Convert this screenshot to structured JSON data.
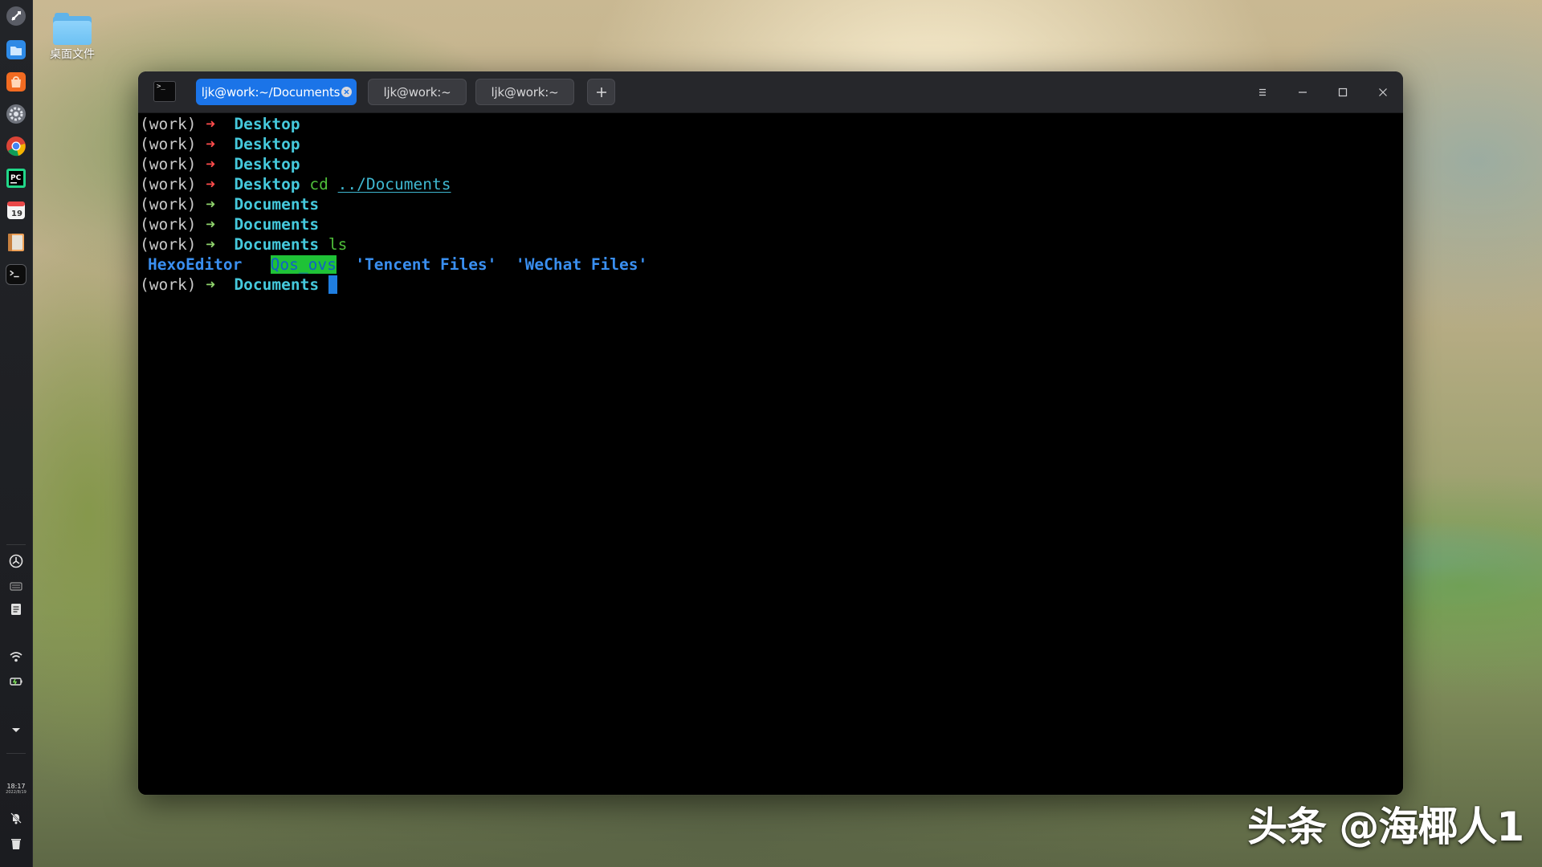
{
  "desktop": {
    "folder_label": "桌面文件"
  },
  "dock": {
    "apps": [
      "launcher-icon",
      "file-manager-icon",
      "app-store-icon",
      "settings-icon",
      "chrome-icon",
      "pycharm-icon",
      "calendar-icon",
      "notes-icon",
      "terminal-icon"
    ],
    "calendar_day": "19",
    "pycharm_text": "PC",
    "clock_time": "18:17",
    "clock_date": "2022/8/19"
  },
  "terminal": {
    "icon_text": ">_",
    "tabs": [
      {
        "label": "ljk@work:~/Documents",
        "active": true
      },
      {
        "label": "ljk@work:~",
        "active": false
      },
      {
        "label": "ljk@work:~",
        "active": false
      }
    ],
    "new_tab_label": "+",
    "lines": [
      {
        "env": "(work)",
        "arrow": "➜",
        "dir": "Desktop",
        "cmd": "",
        "arg": ""
      },
      {
        "env": "(work)",
        "arrow": "➜",
        "dir": "Desktop",
        "cmd": "",
        "arg": ""
      },
      {
        "env": "(work)",
        "arrow": "➜",
        "dir": "Desktop",
        "cmd": "",
        "arg": ""
      },
      {
        "env": "(work)",
        "arrow": "➜",
        "dir": "Desktop",
        "cmd": "cd",
        "arg": "../Documents"
      },
      {
        "env": "(work)",
        "arrow": "➜",
        "dir": "Documents",
        "cmd": "",
        "arg": ""
      },
      {
        "env": "(work)",
        "arrow": "➜",
        "dir": "Documents",
        "cmd": "",
        "arg": ""
      },
      {
        "env": "(work)",
        "arrow": "➜",
        "dir": "Documents",
        "cmd": "ls",
        "arg": ""
      }
    ],
    "ls_output": [
      "HexoEditor",
      "Qos_ovs",
      "'Tencent Files'",
      "'WeChat Files'"
    ],
    "current_prompt": {
      "env": "(work)",
      "arrow": "➜",
      "dir": "Documents"
    }
  },
  "watermark": "头条 @海椰人1",
  "colors": {
    "tab_active": "#1b74e8",
    "arrow_error": "#ff4c4c",
    "arrow_ok": "#8fd36c",
    "dir": "#45c9dc",
    "command": "#4fbf3a",
    "ls_dir": "#3a8ff0",
    "ls_highlight_bg": "#1fc237",
    "cursor": "#1f7ee0"
  }
}
